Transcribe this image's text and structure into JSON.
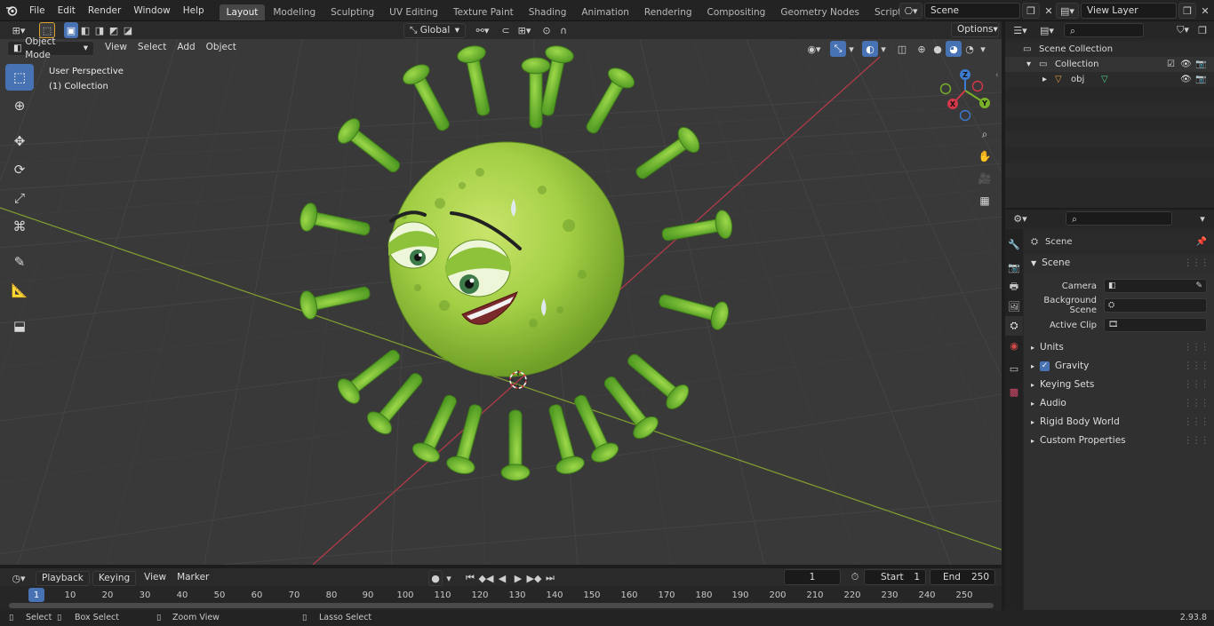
{
  "menu": [
    "File",
    "Edit",
    "Render",
    "Window",
    "Help"
  ],
  "workspaces": [
    {
      "label": "Layout",
      "active": true
    },
    {
      "label": "Modeling"
    },
    {
      "label": "Sculpting"
    },
    {
      "label": "UV Editing"
    },
    {
      "label": "Texture Paint"
    },
    {
      "label": "Shading"
    },
    {
      "label": "Animation"
    },
    {
      "label": "Rendering"
    },
    {
      "label": "Compositing"
    },
    {
      "label": "Geometry Nodes"
    },
    {
      "label": "Scripting"
    }
  ],
  "scene_name": "Scene",
  "view_layer": "View Layer",
  "viewport": {
    "mode": "Object Mode",
    "menus": [
      "View",
      "Select",
      "Add",
      "Object"
    ],
    "orientation": "Global",
    "options_label": "Options",
    "info_line1": "User Perspective",
    "info_line2": "(1) Collection",
    "axis": {
      "x": "X",
      "y": "Y",
      "z": "Z"
    }
  },
  "outliner": {
    "scene_collection": "Scene Collection",
    "collection": "Collection",
    "object": "obj"
  },
  "properties": {
    "header": "Scene",
    "panel": "Scene",
    "fields": [
      {
        "label": "Camera",
        "icon": "camera-icon"
      },
      {
        "label": "Background Scene",
        "icon": "scene-icon"
      },
      {
        "label": "Active Clip",
        "icon": "clip-icon"
      }
    ],
    "subpanels": [
      {
        "label": "Units"
      },
      {
        "label": "Gravity",
        "checkbox": true
      },
      {
        "label": "Keying Sets"
      },
      {
        "label": "Audio"
      },
      {
        "label": "Rigid Body World"
      },
      {
        "label": "Custom Properties"
      }
    ]
  },
  "timeline": {
    "menus": [
      "Playback",
      "Keying",
      "View",
      "Marker"
    ],
    "current_frame": "1",
    "start_label": "Start",
    "start": "1",
    "end_label": "End",
    "end": "250",
    "ruler": [
      "1",
      "10",
      "20",
      "30",
      "40",
      "50",
      "60",
      "70",
      "80",
      "90",
      "100",
      "110",
      "120",
      "130",
      "140",
      "150",
      "160",
      "170",
      "180",
      "190",
      "200",
      "210",
      "220",
      "230",
      "240",
      "250"
    ]
  },
  "status": {
    "select": "Select",
    "box_select": "Box Select",
    "zoom_view": "Zoom View",
    "lasso_select": "Lasso Select",
    "version": "2.93.8"
  }
}
